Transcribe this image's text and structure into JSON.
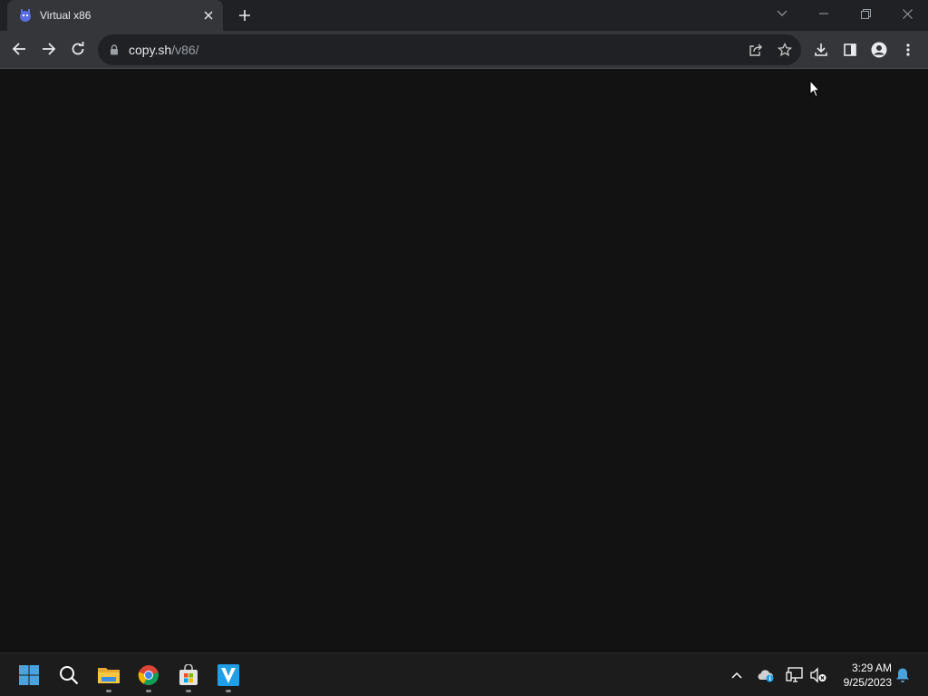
{
  "window": {
    "tab": {
      "title": "Virtual x86",
      "favicon": "v86-favicon-icon"
    },
    "new_tab_icon": "plus-icon",
    "controls": [
      "tab-search-icon",
      "minimize-icon",
      "restore-icon",
      "close-icon"
    ]
  },
  "toolbar": {
    "back_icon": "arrow-left-icon",
    "forward_icon": "arrow-right-icon",
    "reload_icon": "reload-icon",
    "url_host": "copy.sh",
    "url_path": "/v86/",
    "share_icon": "share-icon",
    "bookmark_icon": "star-icon",
    "download_icon": "download-icon",
    "side_panel_icon": "side-panel-icon",
    "profile_icon": "profile-icon",
    "menu_icon": "kebab-menu-icon"
  },
  "page": {
    "background": "#121212"
  },
  "taskbar": {
    "apps": [
      "windows-start-icon",
      "search-icon",
      "file-explorer-icon",
      "chrome-icon",
      "microsoft-store-icon",
      "v-app-icon"
    ],
    "tray": [
      "chevron-up-icon",
      "onedrive-icon",
      "network-icon",
      "volume-muted-icon",
      "notification-bell-icon"
    ],
    "time": "3:29 AM",
    "date": "9/25/2023"
  },
  "colors": {
    "titlebar": "#202124",
    "toolbar": "#35363a",
    "omnibox": "#202124",
    "taskbar": "#1c1c1c",
    "accent_blue": "#4aa3df"
  }
}
